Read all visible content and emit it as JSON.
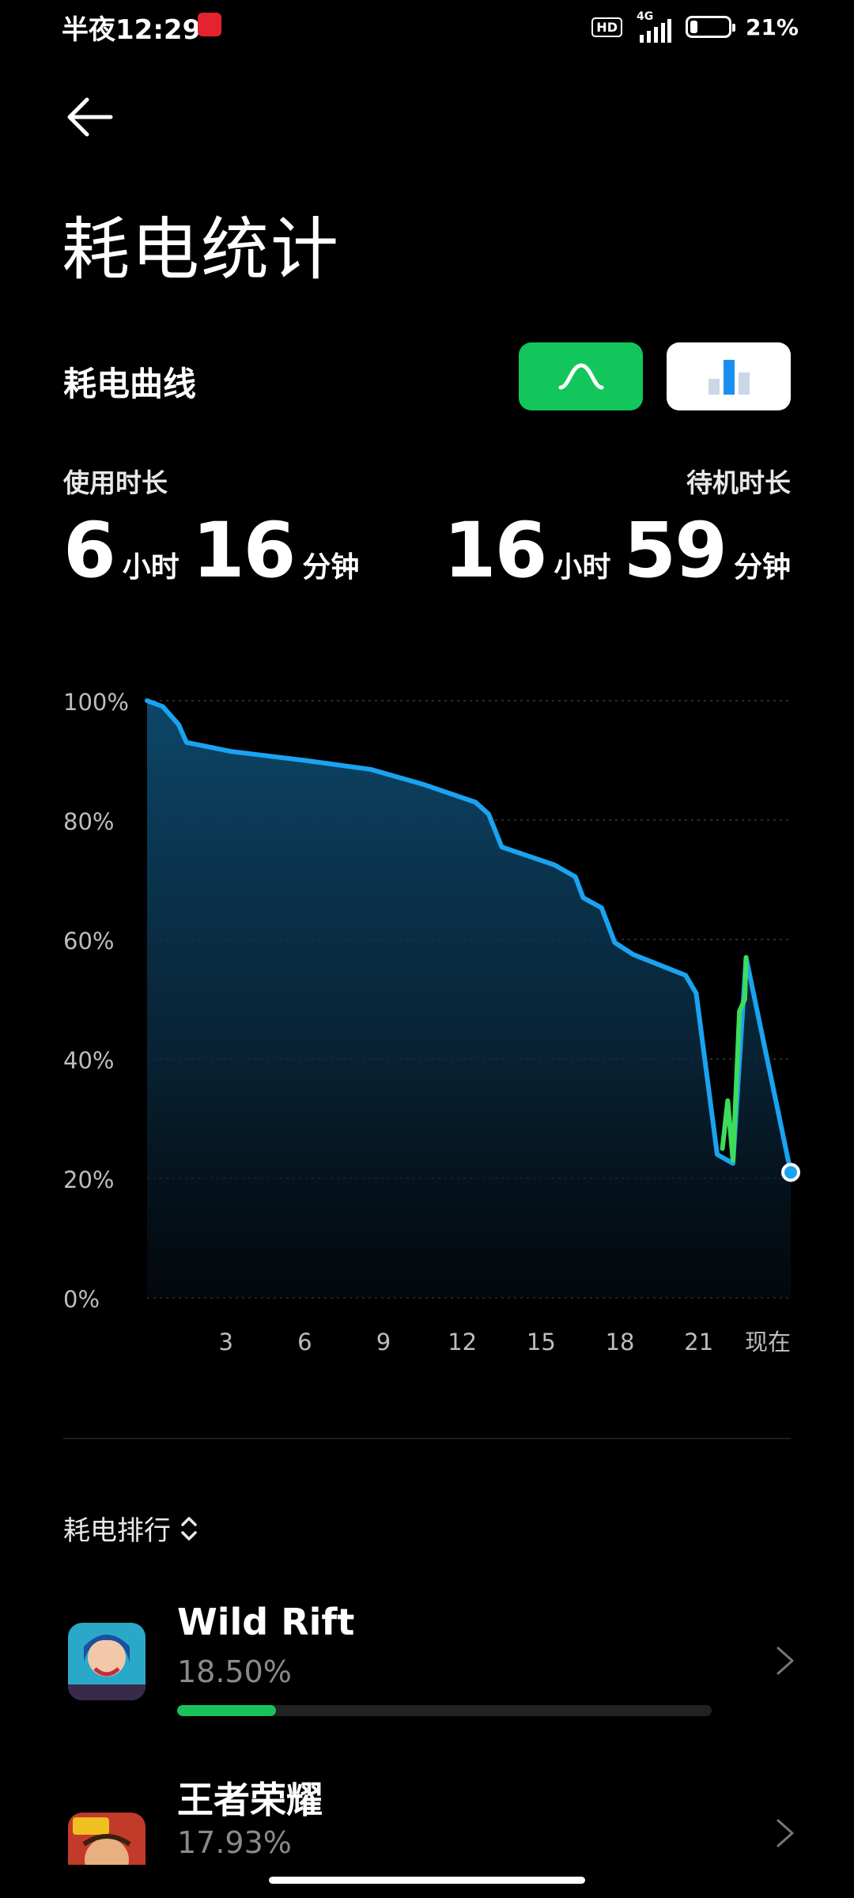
{
  "status_bar": {
    "time": "半夜12:29",
    "hd": "HD",
    "network": "4G",
    "battery_level": 0.21,
    "battery_text": "21%"
  },
  "header": {
    "back_icon": "back-arrow-icon",
    "title": "耗电统计"
  },
  "curve_section": {
    "title": "耗电曲线",
    "toggle_curve_icon": "curve-icon",
    "toggle_bars_icon": "bar-chart-icon",
    "active_toggle": "curve"
  },
  "usage": {
    "label": "使用时长",
    "hours": "6",
    "hours_unit": "小时",
    "minutes": "16",
    "minutes_unit": "分钟"
  },
  "standby": {
    "label": "待机时长",
    "hours": "16",
    "hours_unit": "小时",
    "minutes": "59",
    "minutes_unit": "分钟"
  },
  "chart_data": {
    "type": "area",
    "x_tick_labels": [
      "3",
      "6",
      "9",
      "12",
      "15",
      "18",
      "21",
      "现在"
    ],
    "y_tick_labels": [
      "100%",
      "80%",
      "60%",
      "40%",
      "20%",
      "0%"
    ],
    "ylim": [
      0,
      100
    ],
    "xlim": [
      0,
      24.5
    ],
    "grid": true,
    "colors": {
      "discharge": "#1aa3f0",
      "charging": "#3ddc5a"
    },
    "series": [
      {
        "values": [
          [
            0,
            100
          ],
          [
            0.6,
            99
          ],
          [
            1.2,
            96
          ],
          [
            1.5,
            93
          ],
          [
            3.2,
            91.5
          ],
          [
            6,
            90
          ],
          [
            8.5,
            88.5
          ],
          [
            10.5,
            86
          ],
          [
            12.5,
            83
          ],
          [
            13.0,
            81
          ],
          [
            13.5,
            75.5
          ],
          [
            14.5,
            74
          ],
          [
            15.5,
            72.5
          ],
          [
            16.3,
            70.5
          ],
          [
            16.6,
            67
          ],
          [
            17.3,
            65.3
          ],
          [
            17.8,
            59.5
          ],
          [
            18.5,
            57.5
          ],
          [
            20.5,
            54
          ],
          [
            20.9,
            51
          ],
          [
            21.7,
            24
          ],
          [
            22.3,
            22.5
          ],
          [
            22.8,
            57
          ],
          [
            24.5,
            21
          ]
        ]
      }
    ],
    "charging_segments": [
      [
        [
          21.9,
          25
        ],
        [
          22.1,
          33
        ],
        [
          22.3,
          23
        ],
        [
          22.55,
          48
        ],
        [
          22.75,
          50
        ],
        [
          22.8,
          57
        ]
      ]
    ]
  },
  "ranking": {
    "title": "耗电排行",
    "sort_icon": "sort-updown-icon",
    "items": [
      {
        "name": "Wild Rift",
        "percent": "18.50%",
        "share": 0.185,
        "icon": "wild-rift-app-icon"
      },
      {
        "name": "王者荣耀",
        "percent": "17.93%",
        "share": 0.1793,
        "icon": "honor-of-kings-app-icon"
      }
    ]
  }
}
